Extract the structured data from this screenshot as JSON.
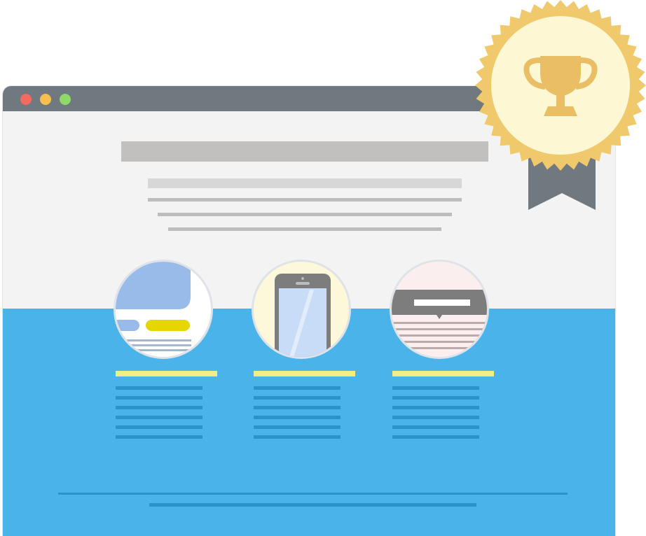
{
  "window": {
    "controls": [
      "close-dot",
      "minimize-dot",
      "maximize-dot"
    ],
    "colors": {
      "titlebar": "#707880",
      "hero_background": "#f3f3f3",
      "blue_background": "#4ab4ea",
      "accent_yellow": "#f2ef82",
      "badge_gold": "#f0c96c",
      "ribbon": "#707880"
    }
  },
  "features": [
    {
      "icon": "web-layout-icon"
    },
    {
      "icon": "smartphone-icon"
    },
    {
      "icon": "browser-popup-icon"
    }
  ],
  "badge": {
    "icon": "trophy-icon"
  }
}
